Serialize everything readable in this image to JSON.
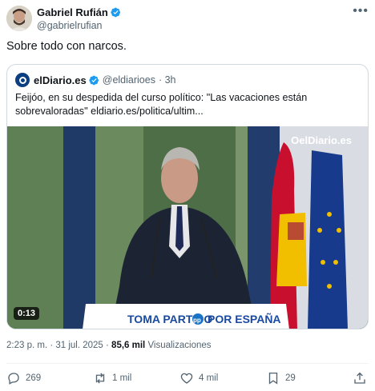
{
  "author": {
    "name": "Gabriel Rufián",
    "handle": "@gabrielrufian"
  },
  "tweet": {
    "text": "Sobre todo con narcos."
  },
  "quote": {
    "name": "elDiario.es",
    "handle": "@eldiarioes",
    "time": "· 3h",
    "text": "Feijóo, en su despedida del curso político: \"Las vacaciones están sobrevaloradas\" eldiario.es/politica/ultim...",
    "video": {
      "watermark": "OelDiario.es",
      "podium_text_left": "TOMA PARTIDO",
      "podium_text_mid": "pp",
      "podium_text_right": "POR ESPAÑA",
      "duration": "0:13"
    }
  },
  "meta": {
    "time": "2:23 p. m. · 31 jul. 2025 · ",
    "views_count": "85,6 mil",
    "views_label": " Visualizaciones"
  },
  "actions": {
    "replies": "269",
    "reposts": "1 mil",
    "likes": "4 mil",
    "bookmarks": "29"
  },
  "colors": {
    "verified": "#1d9bf0",
    "muted": "#536471"
  }
}
